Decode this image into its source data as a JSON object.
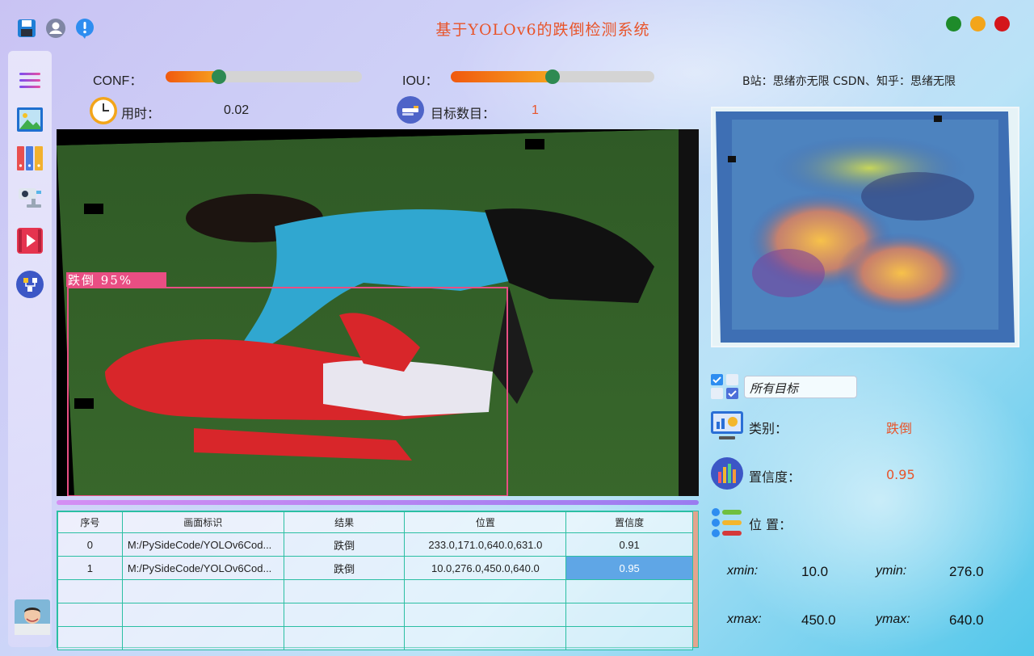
{
  "app": {
    "title": "基于YOLOv6的跌倒检测系统",
    "credit": "B站：思绪亦无限  CSDN、知乎：思绪无限"
  },
  "top_icons": [
    "save-icon",
    "user-icon",
    "alert-icon"
  ],
  "window_controls": {
    "colors": [
      "#1e8b2a",
      "#f3a51a",
      "#d4161b"
    ]
  },
  "sidebar": {
    "items": [
      "menu-icon",
      "image-icon",
      "folder-icon",
      "camera-icon",
      "video-icon",
      "model-icon"
    ]
  },
  "controls": {
    "conf_label": "CONF：",
    "conf_value": 0.27,
    "iou_label": "IOU：",
    "iou_value": 0.5,
    "time_label": "用时：",
    "time_value": "0.02",
    "count_label": "目标数目：",
    "count_value": "1"
  },
  "detection": {
    "label": "跌倒 95%",
    "box_color": "#e94e83"
  },
  "table": {
    "headers": [
      "序号",
      "画面标识",
      "结果",
      "位置",
      "置信度"
    ],
    "rows": [
      {
        "id": "0",
        "source": "M:/PySideCode/YOLOv6Cod...",
        "result": "跌倒",
        "position": "233.0,171.0,640.0,631.0",
        "confidence": "0.91"
      },
      {
        "id": "1",
        "source": "M:/PySideCode/YOLOv6Cod...",
        "result": "跌倒",
        "position": "10.0,276.0,450.0,640.0",
        "confidence": "0.95"
      }
    ]
  },
  "right": {
    "filter_value": "所有目标",
    "class_label": "类别：",
    "class_value": "跌倒",
    "conf_label": "置信度：",
    "conf_value": "0.95",
    "pos_label": "位 置：",
    "xmin_label": "xmin:",
    "xmin_value": "10.0",
    "ymin_label": "ymin:",
    "ymin_value": "276.0",
    "xmax_label": "xmax:",
    "xmax_value": "450.0",
    "ymax_label": "ymax:",
    "ymax_value": "640.0"
  }
}
